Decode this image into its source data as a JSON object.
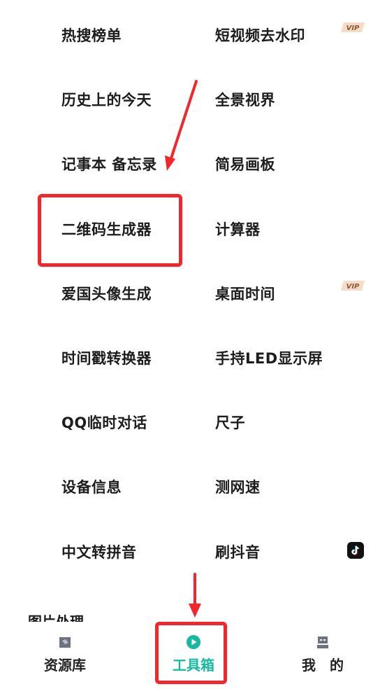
{
  "tools": [
    {
      "left": "热搜榜单",
      "right": "短视频去水印",
      "right_badge": "vip"
    },
    {
      "left": "历史上的今天",
      "right": "全景视界"
    },
    {
      "left": "记事本 备忘录",
      "right": "简易画板"
    },
    {
      "left": "二维码生成器",
      "right": "计算器"
    },
    {
      "left": "爱国头像生成",
      "right": "桌面时间",
      "right_badge": "vip"
    },
    {
      "left": "时间戳转换器",
      "right": "手持LED显示屏"
    },
    {
      "left": "QQ临时对话",
      "right": "尺子"
    },
    {
      "left": "设备信息",
      "right": "测网速"
    },
    {
      "left": "中文转拼音",
      "right": "刷抖音",
      "right_badge": "tiktok"
    }
  ],
  "badges": {
    "vip_text": "VIP"
  },
  "next_section_peek": "图片处理",
  "tabbar": {
    "resources": "资源库",
    "tools": "工具箱",
    "mine": "我　的",
    "active_color": "#16b99e"
  },
  "annotation_color": "#f2262b"
}
